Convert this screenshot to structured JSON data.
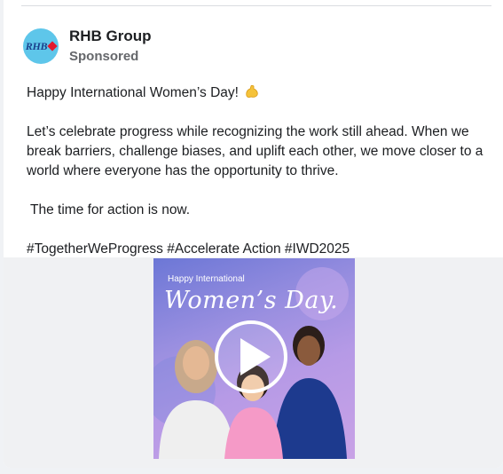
{
  "post": {
    "page_name": "RHB Group",
    "sponsored_label": "Sponsored",
    "avatar_logo_text": "RHB",
    "text_line1": "Happy International Women’s Day!",
    "text_para2": "Let’s celebrate progress while recognizing the work still ahead. When we break barriers, challenge biases, and uplift each other, we move closer to a world where everyone has the opportunity to thrive.",
    "text_para3": " The time for action is now.",
    "hashtags": "#TogetherWeProgress #Accelerate Action #IWD2025",
    "emoji_icon": "flexed-biceps-icon"
  },
  "media": {
    "video_caption_small": "Happy International",
    "video_caption_script": "Women’s Day.",
    "play_icon": "play-icon"
  },
  "colors": {
    "avatar_bg": "#5ec6ea",
    "brand_blue": "#1a3f8c",
    "brand_red": "#e3182d",
    "text_primary": "#1c1e21",
    "text_secondary": "#65676b"
  }
}
